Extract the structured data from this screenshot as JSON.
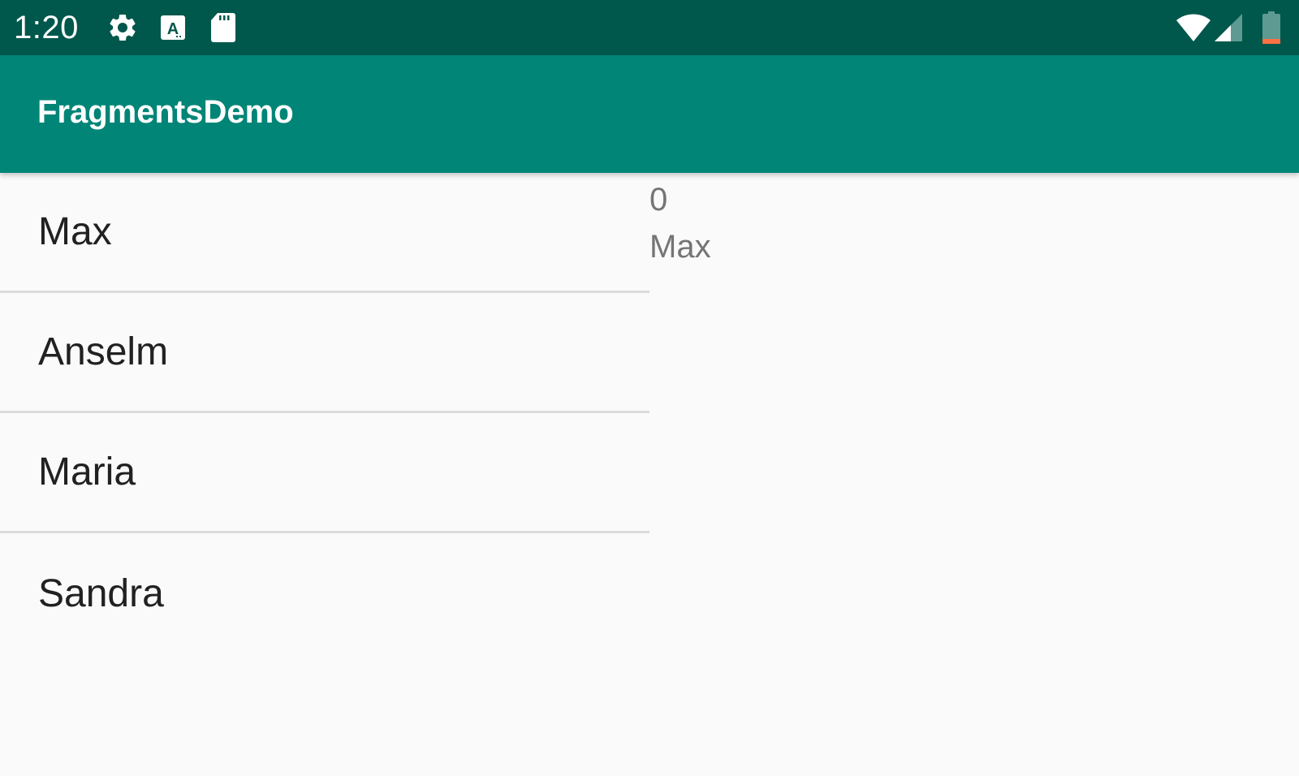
{
  "status_bar": {
    "time": "1:20",
    "icons": [
      "gear-icon",
      "keyboard-a-icon",
      "sd-card-icon",
      "wifi-icon",
      "cell-signal-icon",
      "battery-icon"
    ],
    "bg_color": "#00574b"
  },
  "app_bar": {
    "title": "FragmentsDemo",
    "bg_color": "#008577"
  },
  "list": {
    "items": [
      {
        "label": "Max"
      },
      {
        "label": "Anselm"
      },
      {
        "label": "Maria"
      },
      {
        "label": "Sandra"
      }
    ]
  },
  "detail": {
    "id": "0",
    "name": "Max"
  }
}
